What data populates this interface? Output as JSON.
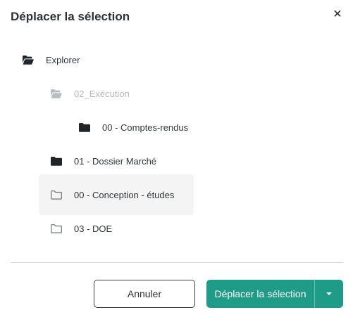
{
  "dialog": {
    "title": "Déplacer la sélection",
    "close_symbol": "✕"
  },
  "tree": {
    "items": [
      {
        "label": "Explorer",
        "icon": "folder-open-icon",
        "state": "normal"
      },
      {
        "label": "02_Exécution",
        "icon": "folder-open-icon",
        "state": "disabled"
      },
      {
        "label": "00 - Comptes-rendus",
        "icon": "folder-filled-icon",
        "state": "normal"
      },
      {
        "label": "01 - Dossier Marché",
        "icon": "folder-filled-icon",
        "state": "normal"
      },
      {
        "label": "00 - Conception - études",
        "icon": "folder-outline-icon",
        "state": "selected"
      },
      {
        "label": "03 - DOE",
        "icon": "folder-outline-icon",
        "state": "normal"
      }
    ]
  },
  "footer": {
    "cancel_label": "Annuler",
    "confirm_label": "Déplacer la sélection",
    "dropdown_icon": "caret-down-icon"
  },
  "colors": {
    "primary": "#1f9c87",
    "selected_bg": "#f4f4f4",
    "disabled_text": "#b4b8bb",
    "text": "#30373c"
  }
}
